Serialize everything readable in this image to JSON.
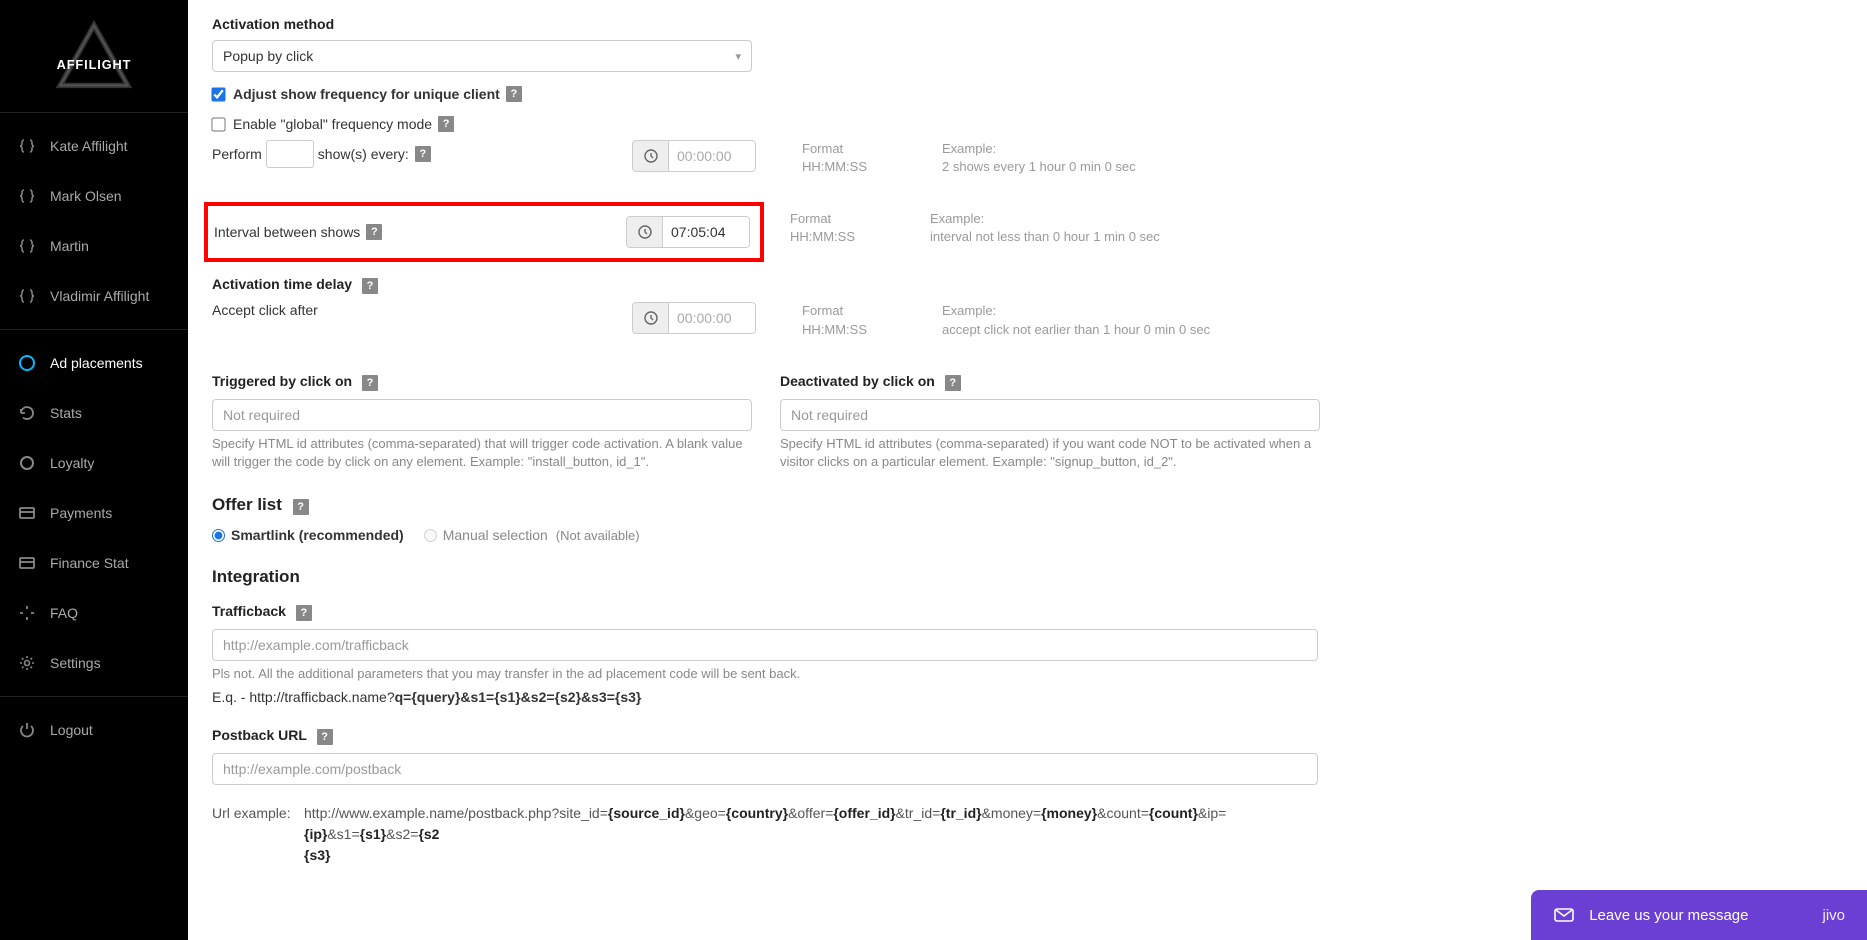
{
  "brand": "AFFILIGHT",
  "sidebar": {
    "users": [
      "Kate Affilight",
      "Mark Olsen",
      "Martin",
      "Vladimir Affilight"
    ],
    "nav": {
      "ad_placements": "Ad placements",
      "stats": "Stats",
      "loyalty": "Loyalty",
      "payments": "Payments",
      "finance_stat": "Finance Stat",
      "faq": "FAQ",
      "settings": "Settings",
      "logout": "Logout"
    }
  },
  "form": {
    "activation_method_label": "Activation method",
    "activation_method_value": "Popup by click",
    "adjust_freq_label": "Adjust show frequency for unique client",
    "global_freq_label": "Enable \"global\" frequency mode",
    "perform_prefix": "Perform",
    "perform_suffix": "show(s) every:",
    "perform_placeholder": "00:00:00",
    "interval_label": "Interval between shows",
    "interval_value": "07:05:04",
    "activation_delay_label": "Activation time delay",
    "accept_click_label": "Accept click after",
    "accept_click_placeholder": "00:00:00",
    "format_label": "Format",
    "format_value": "HH:MM:SS",
    "example_label": "Example:",
    "example_perform": "2 shows every 1 hour 0 min 0 sec",
    "example_interval": "interval not less than 0 hour 1 min 0 sec",
    "example_accept": "accept click not earlier than 1 hour 0 min 0 sec",
    "triggered_label": "Triggered by click on",
    "triggered_placeholder": "Not required",
    "triggered_help": "Specify HTML id attributes (comma-separated) that will trigger code activation. A blank value will trigger the code by click on any element. Example: \"install_button, id_1\".",
    "deactivated_label": "Deactivated by click on",
    "deactivated_placeholder": "Not required",
    "deactivated_help": "Specify HTML id attributes (comma-separated) if you want code NOT to be activated when a visitor clicks on a particular element. Example: \"signup_button, id_2\"."
  },
  "offers": {
    "title": "Offer list",
    "smartlink": "Smartlink (recommended)",
    "manual": "Manual selection",
    "na": "(Not available)"
  },
  "integration": {
    "title": "Integration",
    "trafficback_label": "Trafficback",
    "trafficback_placeholder": "http://example.com/trafficback",
    "trafficback_help1": "Pls not. All the additional parameters that you may transfer in the ad placement code will be sent back.",
    "trafficback_help2_prefix": "E.q. - http://trafficback.name?",
    "trafficback_help2_bold": "q={query}&s1={s1}&s2={s2}&s3={s3}",
    "postback_label": "Postback URL",
    "postback_placeholder": "http://example.com/postback",
    "url_example_label": "Url example:",
    "url_example_prefix": "http://www.example.name/postback.php?site_id=",
    "url_example_parts": {
      "p1": "{source_id}",
      "t1": "&geo=",
      "p2": "{country}",
      "t2": "&offer=",
      "p3": "{offer_id}",
      "t3": "&tr_id=",
      "p4": "{tr_id}",
      "t4": "&money=",
      "p5": "{money}",
      "t5": "&count=",
      "p6": "{count}",
      "t6": "&ip=",
      "p7": "{ip}",
      "t7": "&s1=",
      "p8": "{s1}",
      "t8": "&s2=",
      "p9": "{s2",
      "t9": "",
      "p10": "{s3}"
    }
  },
  "chat": {
    "message": "Leave us your message",
    "brand": "jivo"
  }
}
